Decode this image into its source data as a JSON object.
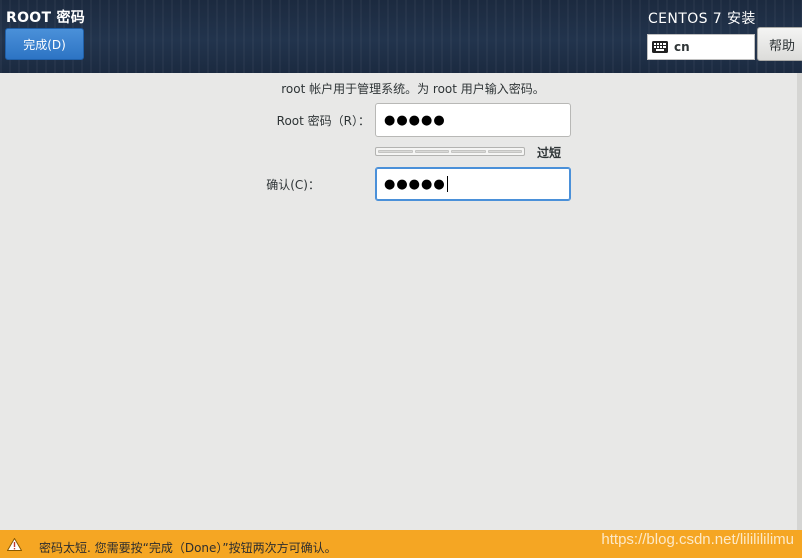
{
  "header": {
    "spoke_title": "ROOT 密码",
    "done_label": "完成(D)",
    "product_title": "CENTOS 7 安装",
    "keyboard_layout": "cn",
    "help_label": "帮助"
  },
  "form": {
    "intro": "root 帐户用于管理系统。为 root 用户输入密码。",
    "root_password_label": "Root 密码（R）：",
    "root_password_value": "●●●●●",
    "strength_label": "过短",
    "strength_fraction": 0,
    "confirm_label": "确认(C)：",
    "confirm_value": "●●●●●"
  },
  "warning": {
    "text": "密码太短. 您需要按“完成（Done）”按钮两次方可确认。",
    "color": "#f5a623"
  },
  "watermark": "https://blog.csdn.net/lililililimu",
  "icons": {
    "keyboard": "keyboard-icon",
    "warning": "warning-icon"
  }
}
